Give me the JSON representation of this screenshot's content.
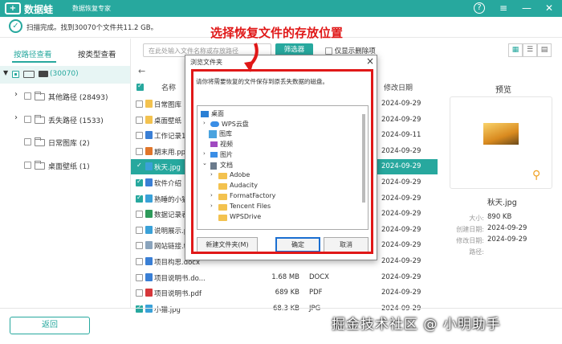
{
  "app": {
    "name": "数据蛙",
    "subtitle": "数据恢复专家",
    "logo": "+",
    "help_icon": "?",
    "menu_icon": "≡",
    "min_icon": "—",
    "close_icon": "✕"
  },
  "scan": {
    "status": "扫描完成。找到30070个文件共11.2 GB。"
  },
  "left_tabs": [
    {
      "label": "按路径查看"
    },
    {
      "label": "按类型查看"
    }
  ],
  "tree": {
    "root_count": "(30070)",
    "items": [
      {
        "label": "其他路径 (28493)"
      },
      {
        "label": "丢失路径 (1533)"
      },
      {
        "label": "日常图库 (2)"
      },
      {
        "label": "桌面壁纸 (1)"
      }
    ]
  },
  "search": {
    "placeholder": "在此处输入文件名称或存放路径"
  },
  "filter_label": "筛选器",
  "deleted_only_label": "仅显示删除项",
  "columns": {
    "name": "名称",
    "modified": "修改日期"
  },
  "files": [
    {
      "name": "日常图库",
      "size": "",
      "type": "",
      "date": "2024-09-29",
      "checked": false,
      "icon": "folder"
    },
    {
      "name": "桌面壁纸",
      "size": "",
      "type": "",
      "date": "2024-09-29",
      "checked": false,
      "icon": "folder"
    },
    {
      "name": "工作记录1",
      "size": "",
      "type": "",
      "date": "2024-09-11",
      "checked": false,
      "icon": "doc"
    },
    {
      "name": "期末用.ppt",
      "size": "",
      "type": "",
      "date": "2024-09-29",
      "checked": false,
      "icon": "ppt"
    },
    {
      "name": "秋天.jpg",
      "size": "",
      "type": "",
      "date": "2024-09-29",
      "checked": true,
      "icon": "img"
    },
    {
      "name": "软件介绍",
      "size": "",
      "type": "",
      "date": "2024-09-29",
      "checked": true,
      "icon": "doc"
    },
    {
      "name": "熟睡的小猫",
      "size": "",
      "type": "",
      "date": "2024-09-29",
      "checked": true,
      "icon": "img"
    },
    {
      "name": "数据记录表",
      "size": "",
      "type": "",
      "date": "2024-09-29",
      "checked": false,
      "icon": "xls"
    },
    {
      "name": "说明展示.p",
      "size": "",
      "type": "",
      "date": "2024-09-29",
      "checked": false,
      "icon": "img"
    },
    {
      "name": "网站链接.t",
      "size": "",
      "type": "",
      "date": "2024-09-29",
      "checked": false,
      "icon": "txt"
    },
    {
      "name": "项目构思.docx",
      "size": "",
      "type": "",
      "date": "2024-09-29",
      "checked": false,
      "icon": "doc"
    },
    {
      "name": "项目说明书.do...",
      "size": "1.68 MB",
      "type": "DOCX",
      "date": "2024-09-29",
      "checked": false,
      "icon": "doc"
    },
    {
      "name": "项目说明书.pdf",
      "size": "689 KB",
      "type": "PDF",
      "date": "2024-09-29",
      "checked": false,
      "icon": "pdf"
    },
    {
      "name": "小猫.jpg",
      "size": "68.3 KB",
      "type": "JPG",
      "date": "2024-09-29",
      "checked": true,
      "icon": "img"
    }
  ],
  "preview": {
    "title": "预览",
    "file_name": "秋天.jpg",
    "fields": [
      {
        "key": "大小:",
        "value": "890 KB"
      },
      {
        "key": "创建日期:",
        "value": "2024-09-29"
      },
      {
        "key": "修改日期:",
        "value": "2024-09-29"
      },
      {
        "key": "路径:",
        "value": ""
      }
    ]
  },
  "back_label": "返回",
  "annotation": "选择恢复文件的存放位置",
  "watermark": "掘金技术社区 @ 小明助手",
  "dialog": {
    "title": "浏览文件夹",
    "message": "请你将需要恢复的文件保存到原丢失数据的磁盘。",
    "tree": [
      "桌面",
      "WPS云盘",
      "图库",
      "视频",
      "图片",
      "文档",
      "Adobe",
      "Audacity",
      "FormatFactory",
      "Tencent Files",
      "WPSDrive"
    ],
    "new_folder": "新建文件夹(M)",
    "ok": "确定",
    "cancel": "取消"
  },
  "colors": {
    "accent": "#27a89e",
    "annotation": "#e01818"
  }
}
